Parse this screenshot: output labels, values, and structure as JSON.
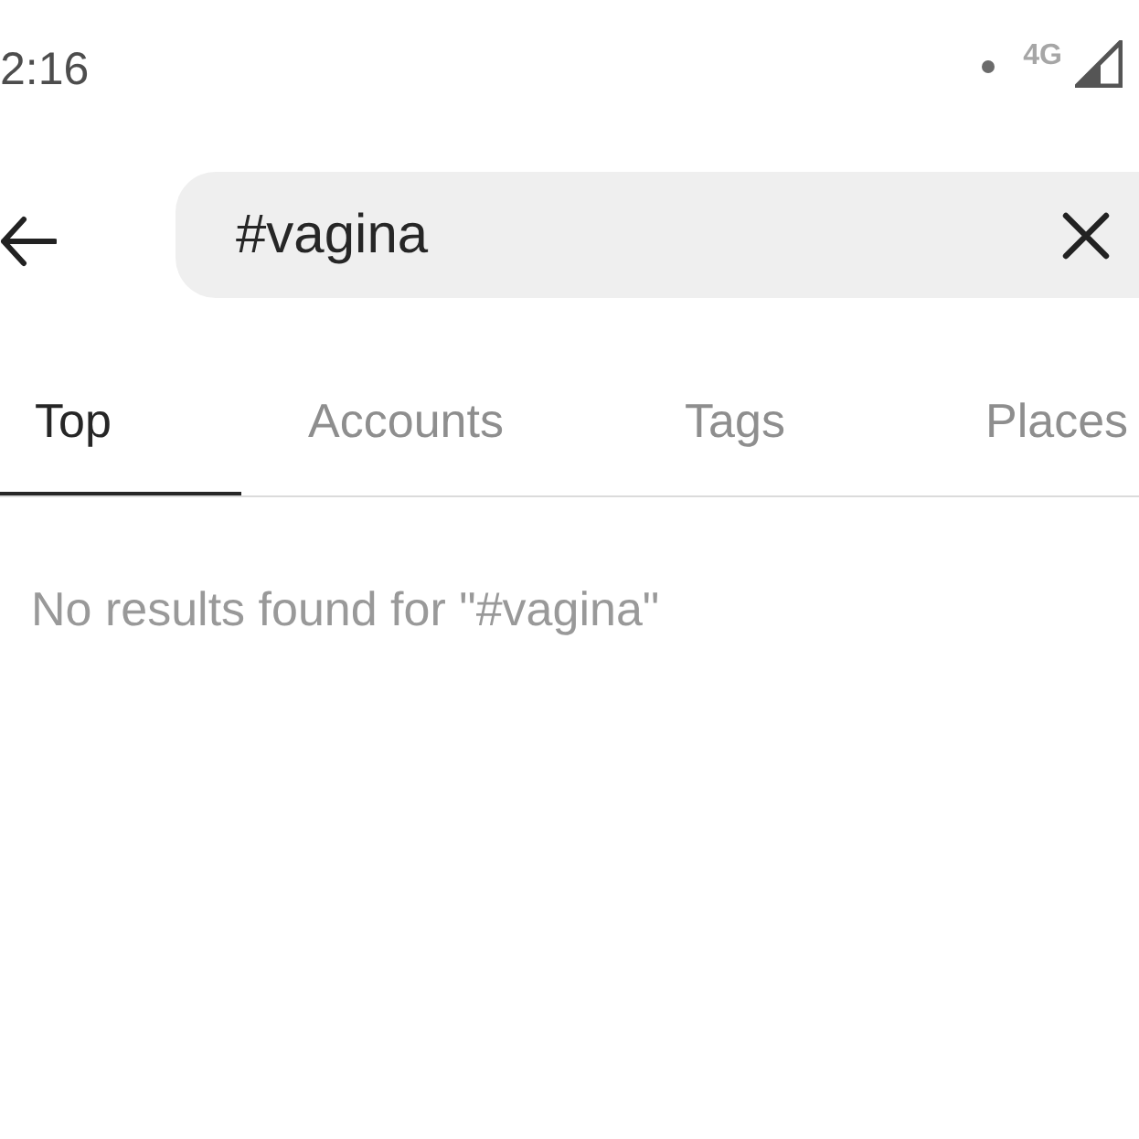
{
  "status_bar": {
    "time": "2:16",
    "network": "4G"
  },
  "search": {
    "value": "#vagina"
  },
  "tabs": [
    {
      "label": "Top",
      "selected": true
    },
    {
      "label": "Accounts",
      "selected": false
    },
    {
      "label": "Tags",
      "selected": false
    },
    {
      "label": "Places",
      "selected": false
    }
  ],
  "message": "No results found for \"#vagina\""
}
